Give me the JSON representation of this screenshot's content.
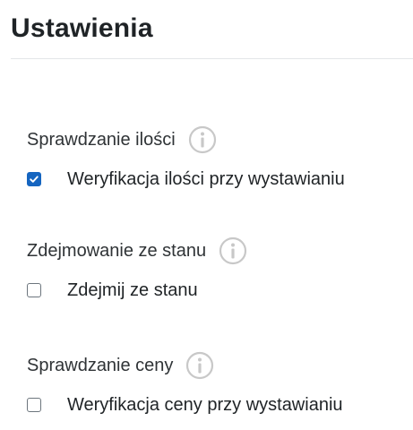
{
  "page": {
    "title": "Ustawienia"
  },
  "settings": [
    {
      "title": "Sprawdzanie ilości",
      "info_icon": "info-circle-icon",
      "checkbox_label": "Weryfikacja ilości przy wystawianiu",
      "checked": true
    },
    {
      "title": "Zdejmowanie ze stanu",
      "info_icon": "info-circle-icon",
      "checkbox_label": "Zdejmij ze stanu",
      "checked": false
    },
    {
      "title": "Sprawdzanie ceny",
      "info_icon": "info-circle-icon",
      "checkbox_label": "Weryfikacja ceny przy wystawianiu",
      "checked": false
    }
  ],
  "colors": {
    "checkbox_checked": "#1565c0",
    "info_icon": "#c8c8c8"
  }
}
